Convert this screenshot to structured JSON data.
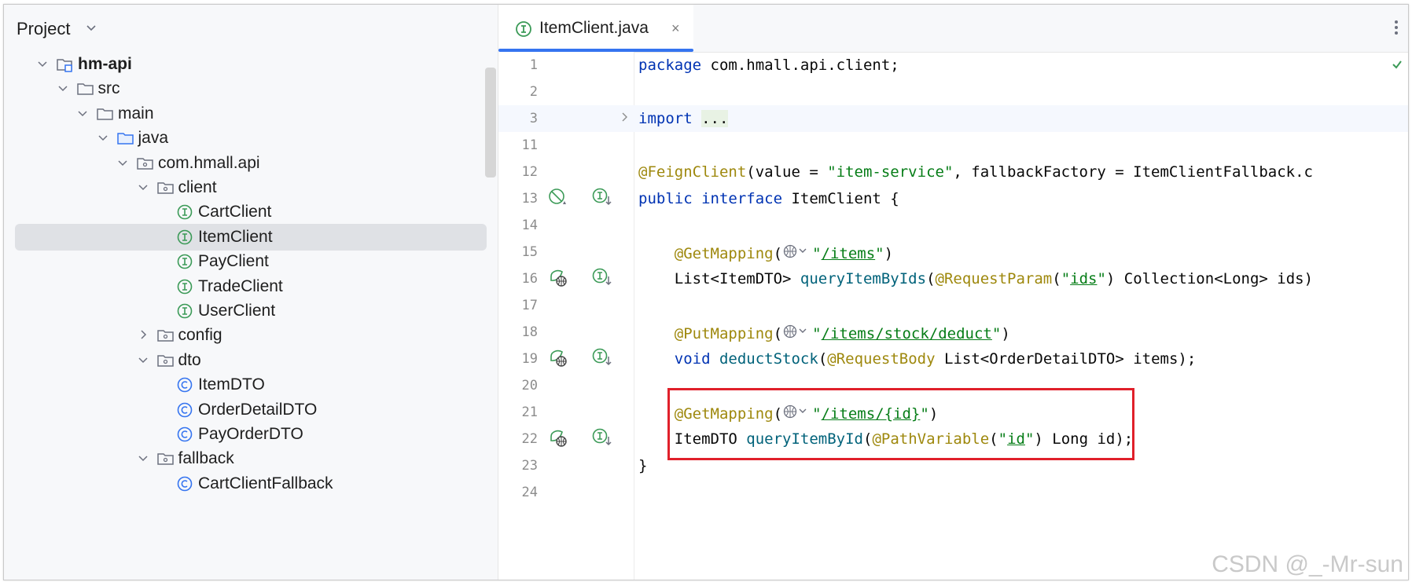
{
  "project_panel": {
    "title": "Project",
    "tree": [
      {
        "label": "hm-api",
        "depth": 0,
        "type": "module",
        "expanded": true,
        "bold": true
      },
      {
        "label": "src",
        "depth": 1,
        "type": "folder",
        "expanded": true
      },
      {
        "label": "main",
        "depth": 2,
        "type": "folder",
        "expanded": true
      },
      {
        "label": "java",
        "depth": 3,
        "type": "source-folder",
        "expanded": true
      },
      {
        "label": "com.hmall.api",
        "depth": 4,
        "type": "package",
        "expanded": true
      },
      {
        "label": "client",
        "depth": 5,
        "type": "package",
        "expanded": true
      },
      {
        "label": "CartClient",
        "depth": 6,
        "type": "interface"
      },
      {
        "label": "ItemClient",
        "depth": 6,
        "type": "interface",
        "selected": true
      },
      {
        "label": "PayClient",
        "depth": 6,
        "type": "interface"
      },
      {
        "label": "TradeClient",
        "depth": 6,
        "type": "interface"
      },
      {
        "label": "UserClient",
        "depth": 6,
        "type": "interface"
      },
      {
        "label": "config",
        "depth": 5,
        "type": "package",
        "expanded": false
      },
      {
        "label": "dto",
        "depth": 5,
        "type": "package",
        "expanded": true
      },
      {
        "label": "ItemDTO",
        "depth": 6,
        "type": "class"
      },
      {
        "label": "OrderDetailDTO",
        "depth": 6,
        "type": "class"
      },
      {
        "label": "PayOrderDTO",
        "depth": 6,
        "type": "class"
      },
      {
        "label": "fallback",
        "depth": 5,
        "type": "package",
        "expanded": true
      },
      {
        "label": "CartClientFallback",
        "depth": 6,
        "type": "class"
      }
    ]
  },
  "editor": {
    "tab_label": "ItemClient.java",
    "tab_close": "×",
    "lines": [
      {
        "num": "1",
        "tokens": [
          [
            "kw",
            "package"
          ],
          [
            "t",
            " com.hmall.api.client;"
          ]
        ]
      },
      {
        "num": "2",
        "tokens": []
      },
      {
        "num": "3",
        "current": true,
        "fold": true,
        "tokens": [
          [
            "kw",
            "import"
          ],
          [
            "t",
            " "
          ],
          [
            "fold",
            "..."
          ]
        ]
      },
      {
        "num": "11",
        "tokens": []
      },
      {
        "num": "12",
        "tokens": [
          [
            "ann",
            "@FeignClient"
          ],
          [
            "t",
            "(value = "
          ],
          [
            "str",
            "\"item-service\""
          ],
          [
            "t",
            ", fallbackFactory = ItemClientFallback.c"
          ]
        ]
      },
      {
        "num": "13",
        "g1": "bean-off-icon",
        "g2": "impl-icon",
        "tokens": [
          [
            "kw",
            "public interface"
          ],
          [
            "t",
            " ItemClient {"
          ]
        ]
      },
      {
        "num": "14",
        "tokens": []
      },
      {
        "num": "15",
        "tokens": [
          [
            "t",
            "    "
          ],
          [
            "ann",
            "@GetMapping"
          ],
          [
            "t",
            "("
          ],
          [
            "globe",
            ""
          ],
          [
            "str",
            "\""
          ],
          [
            "strul",
            "/items"
          ],
          [
            "str",
            "\""
          ],
          [
            "t",
            ")"
          ]
        ]
      },
      {
        "num": "16",
        "g1": "web-bean-icon",
        "g2": "impl-icon",
        "tokens": [
          [
            "t",
            "    List<ItemDTO> "
          ],
          [
            "fn",
            "queryItemByIds"
          ],
          [
            "t",
            "("
          ],
          [
            "ann",
            "@RequestParam"
          ],
          [
            "t",
            "("
          ],
          [
            "str",
            "\""
          ],
          [
            "strul",
            "ids"
          ],
          [
            "str",
            "\""
          ],
          [
            "t",
            ") Collection<Long> ids)"
          ]
        ]
      },
      {
        "num": "17",
        "tokens": []
      },
      {
        "num": "18",
        "tokens": [
          [
            "t",
            "    "
          ],
          [
            "ann",
            "@PutMapping"
          ],
          [
            "t",
            "("
          ],
          [
            "globe",
            ""
          ],
          [
            "str",
            "\""
          ],
          [
            "strul",
            "/items/stock/deduct"
          ],
          [
            "str",
            "\""
          ],
          [
            "t",
            ")"
          ]
        ]
      },
      {
        "num": "19",
        "g1": "web-bean-icon",
        "g2": "impl-icon",
        "tokens": [
          [
            "t",
            "    "
          ],
          [
            "kw",
            "void"
          ],
          [
            "t",
            " "
          ],
          [
            "fn",
            "deductStock"
          ],
          [
            "t",
            "("
          ],
          [
            "ann",
            "@RequestBody"
          ],
          [
            "t",
            " List<OrderDetailDTO> items);"
          ]
        ]
      },
      {
        "num": "20",
        "tokens": []
      },
      {
        "num": "21",
        "tokens": [
          [
            "t",
            "    "
          ],
          [
            "ann",
            "@GetMapping"
          ],
          [
            "t",
            "("
          ],
          [
            "globe",
            ""
          ],
          [
            "str",
            "\""
          ],
          [
            "strul",
            "/items/{id}"
          ],
          [
            "str",
            "\""
          ],
          [
            "t",
            ")"
          ]
        ]
      },
      {
        "num": "22",
        "g1": "web-bean-icon",
        "g2": "impl-icon",
        "tokens": [
          [
            "t",
            "    ItemDTO "
          ],
          [
            "fn",
            "queryItemById"
          ],
          [
            "t",
            "("
          ],
          [
            "ann",
            "@PathVariable"
          ],
          [
            "t",
            "("
          ],
          [
            "str",
            "\""
          ],
          [
            "strul",
            "id"
          ],
          [
            "str",
            "\""
          ],
          [
            "t",
            ") Long id);"
          ]
        ]
      },
      {
        "num": "23",
        "tokens": [
          [
            "t",
            "}"
          ]
        ]
      },
      {
        "num": "24",
        "tokens": []
      }
    ]
  },
  "colors": {
    "accent": "#3574f0",
    "highlight_box": "#e0202a",
    "interface_icon": "#3b9a57",
    "class_icon": "#3574f0"
  },
  "watermark": "CSDN @_-Mr-sun"
}
